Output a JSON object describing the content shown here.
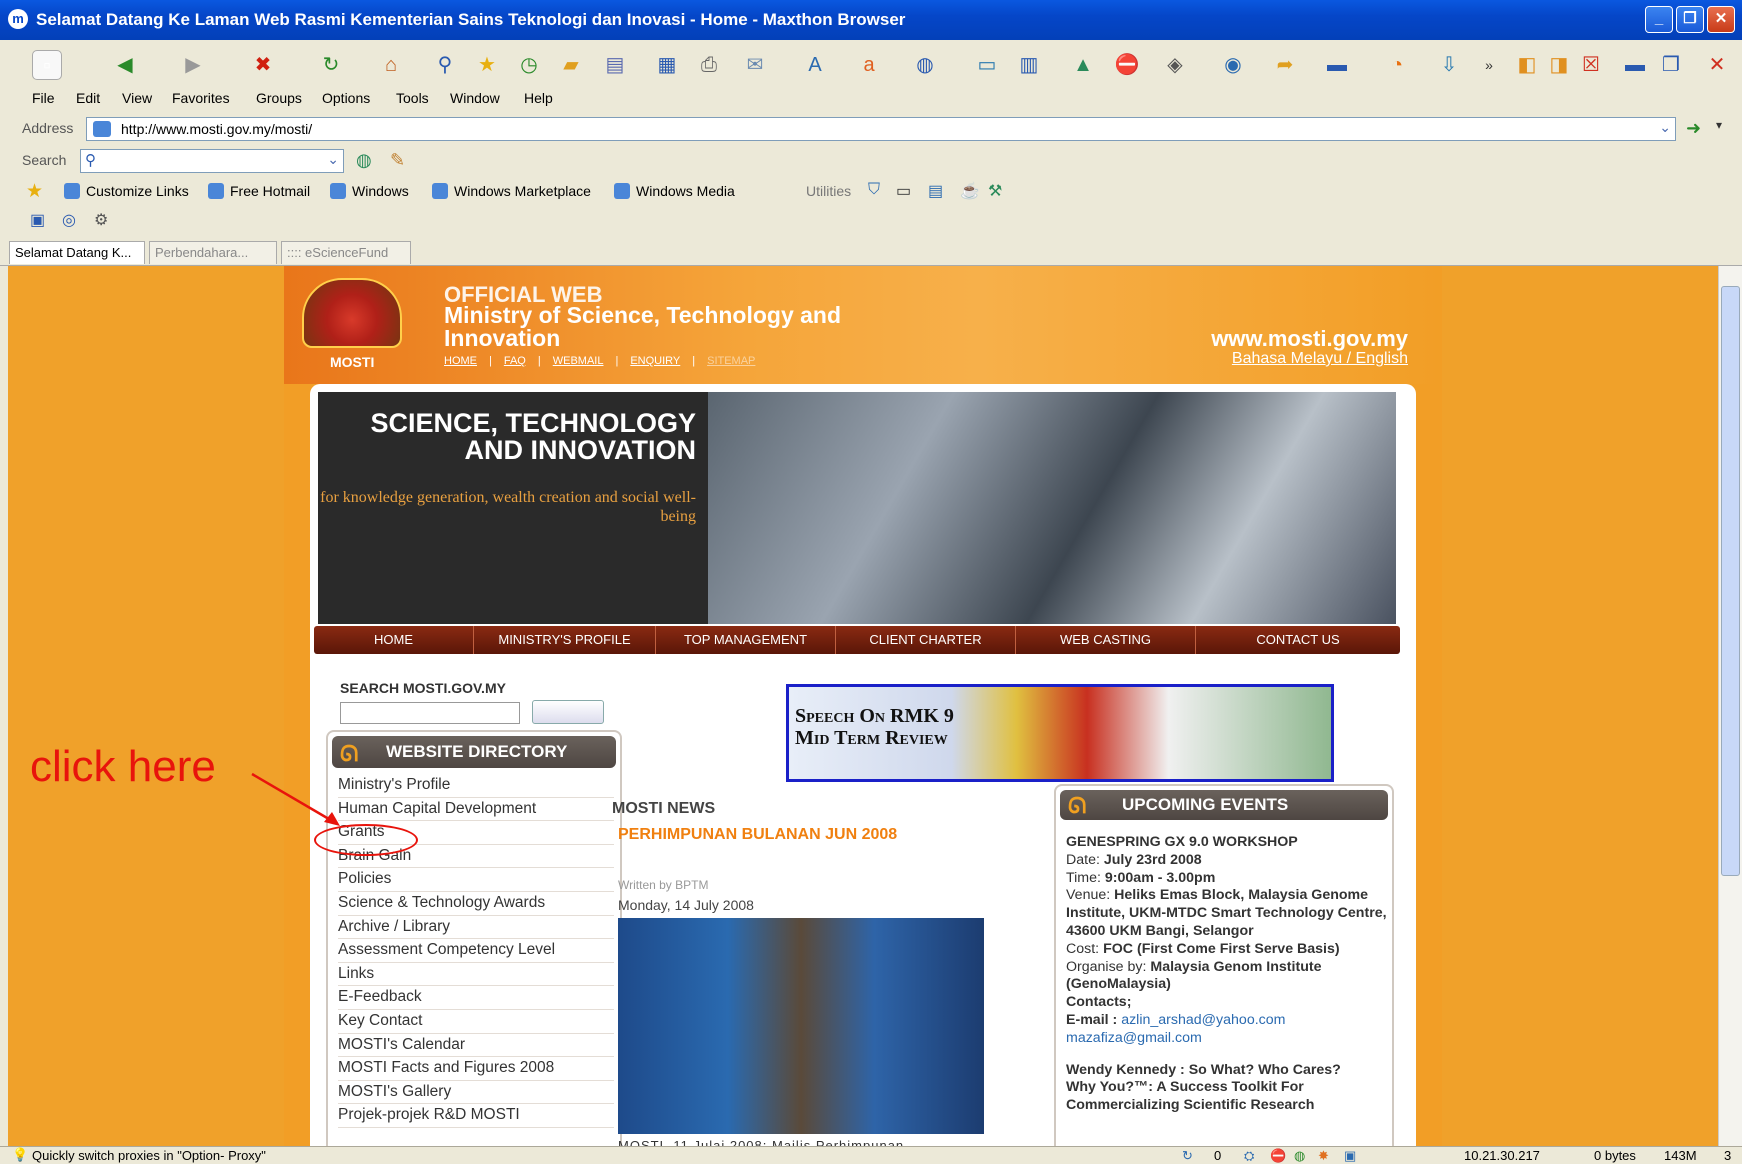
{
  "window": {
    "title": "Selamat Datang Ke Laman Web Rasmi Kementerian Sains Teknologi dan Inovasi - Home - Maxthon Browser",
    "app_icon": "maxthon-icon"
  },
  "menu": [
    "File",
    "Edit",
    "View",
    "Favorites",
    "Groups",
    "Options",
    "Tools",
    "Window",
    "Help"
  ],
  "address": {
    "label": "Address",
    "url": "http://www.mosti.gov.my/mosti/"
  },
  "search_bar": {
    "label": "Search",
    "value": ""
  },
  "links": [
    "Customize Links",
    "Free Hotmail",
    "Windows",
    "Windows Marketplace",
    "Windows Media"
  ],
  "utilities_label": "Utilities",
  "tabs": [
    "Selamat Datang K...",
    "Perbendahara...",
    ":::: eScienceFund"
  ],
  "site": {
    "crest_label": "MOSTI",
    "official": "OFFICIAL WEB",
    "ministry": "Ministry of Science, Technology and Innovation",
    "header_nav": [
      "HOME",
      "FAQ",
      "WEBMAIL",
      "ENQUIRY",
      "SITEMAP"
    ],
    "url": "www.mosti.gov.my",
    "lang": "Bahasa Melayu / English",
    "banner_title": "SCIENCE, TECHNOLOGY AND INNOVATION",
    "banner_sub": "for knowledge generation, wealth creation and social well-being",
    "main_nav": [
      "HOME",
      "MINISTRY'S PROFILE",
      "TOP MANAGEMENT",
      "CLIENT CHARTER",
      "WEB CASTING",
      "CONTACT US"
    ],
    "search_label": "SEARCH MOSTI.GOV.MY",
    "speech_banner": "Speech On RMK 9 Mid Term Review",
    "directory_title": "WEBSITE DIRECTORY",
    "directory": [
      "Ministry's Profile",
      "Human Capital Development",
      "Grants",
      "Brain Gain",
      "Policies",
      "Science & Technology Awards",
      "Archive / Library",
      "Assessment Competency Level",
      "Links",
      "E-Feedback",
      "Key Contact",
      "MOSTI's Calendar",
      "MOSTI Facts and Figures 2008",
      "MOSTI's Gallery",
      "Projek-projek R&D MOSTI"
    ],
    "news": {
      "section": "MOSTI NEWS",
      "headline": "PERHIMPUNAN BULANAN JUN 2008",
      "author": "Written by BPTM",
      "date": "Monday, 14 July 2008",
      "snippet": "MOSTI, 11 Julai 2008: Majlis Perhimpunan"
    },
    "events": {
      "title": "UPCOMING EVENTS",
      "e1_title": "GENESPRING GX 9.0 WORKSHOP",
      "date_label": "Date:",
      "date": "July 23rd 2008",
      "time_label": "Time:",
      "time": "9:00am - 3.00pm",
      "venue_label": "Venue:",
      "venue": "Heliks Emas Block, Malaysia Genome Institute, UKM-MTDC Smart Technology Centre, 43600 UKM Bangi, Selangor",
      "cost_label": "Cost:",
      "cost": "FOC (First Come First Serve Basis)",
      "org_label": "Organise by:",
      "org": "Malaysia Genom Institute (GenoMalaysia)",
      "contacts_label": "Contacts;",
      "email_label": "E-mail :",
      "email1": "azlin_arshad@yahoo.com",
      "email2": "mazafiza@gmail.com",
      "e2_line1": "Wendy Kennedy : So What? Who Cares?",
      "e2_line2": "Why You?™: A Success Toolkit For",
      "e2_line3": "Commercializing Scientific Research"
    }
  },
  "annotation": {
    "text": "click here",
    "color": "#e8140c"
  },
  "status": {
    "message": "Quickly switch proxies in \"Option- Proxy\"",
    "count": "0",
    "ip": "10.21.30.217",
    "bytes": "0 bytes",
    "memory": "143M",
    "tabs_count": "3"
  }
}
